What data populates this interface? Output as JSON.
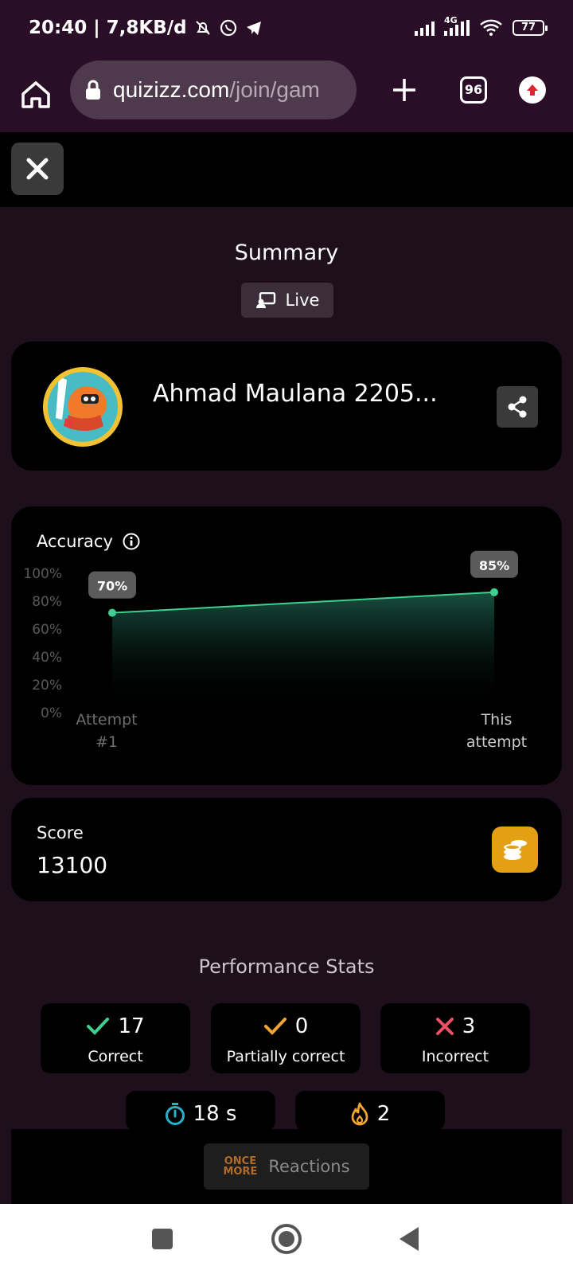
{
  "status_bar": {
    "time_info": "20:40 | 7,8KB/d",
    "network": "4G",
    "battery": "77"
  },
  "browser": {
    "url_host": "quizizz.com",
    "url_path": "/join/gam",
    "tab_count": "96"
  },
  "summary": {
    "title": "Summary",
    "mode": "Live"
  },
  "player": {
    "name": "Ahmad Maulana 2205..."
  },
  "accuracy": {
    "label": "Accuracy"
  },
  "chart_data": {
    "type": "area",
    "title": "Accuracy",
    "categories": [
      "Attempt #1",
      "This attempt"
    ],
    "x_tick_labels": [
      [
        "Attempt",
        "#1"
      ],
      [
        "This",
        "attempt"
      ]
    ],
    "values": [
      70,
      85
    ],
    "data_labels": [
      "70%",
      "85%"
    ],
    "y_ticks": [
      "100%",
      "80%",
      "60%",
      "40%",
      "20%",
      "0%"
    ],
    "ylim": [
      0,
      100
    ],
    "line_color": "#3fcf8e",
    "grid": false
  },
  "score": {
    "label": "Score",
    "value": "13100"
  },
  "performance": {
    "title": "Performance Stats",
    "correct_value": "17",
    "correct_label": "Correct",
    "partial_value": "0",
    "partial_label": "Partially correct",
    "incorrect_value": "3",
    "incorrect_label": "Incorrect",
    "time_value": "18 s",
    "streak_value": "2"
  },
  "reactions": {
    "logo_line1": "ONCE",
    "logo_line2": "MORE",
    "label": "Reactions"
  },
  "colors": {
    "correct": "#3fcf8e",
    "partial": "#f0a531",
    "incorrect": "#ef4f63",
    "timer": "#2ab0c9",
    "streak": "#f0a531",
    "coin": "#e2a012"
  }
}
